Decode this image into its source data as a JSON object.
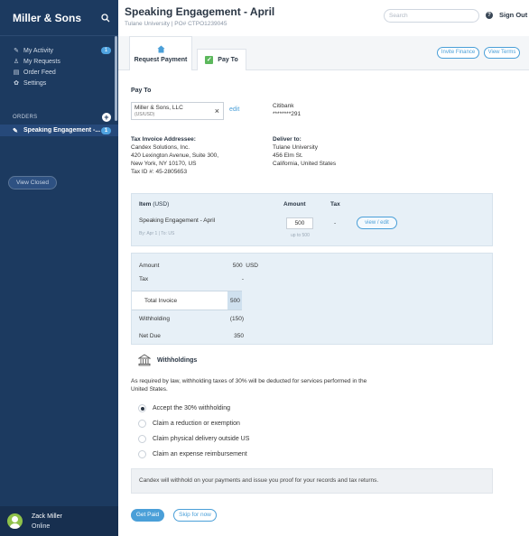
{
  "sidebar": {
    "brand": "Miller & Sons",
    "nav": [
      {
        "label": "My Activity",
        "badge": "1",
        "icon": "activity-icon"
      },
      {
        "label": "My Requests",
        "icon": "person-icon"
      },
      {
        "label": "Order Feed",
        "icon": "document-icon"
      },
      {
        "label": "Settings",
        "icon": "gear-icon"
      }
    ],
    "orders_heading": "ORDERS",
    "active_order": {
      "label": "Speaking Engagement -...",
      "badge": "1"
    },
    "view_closed": "View Closed",
    "user": {
      "name": "Zack Miller",
      "status": "Online"
    }
  },
  "header": {
    "title": "Speaking Engagement - April",
    "subtitle": "Tulane University | PO# CTPO1239045",
    "search_placeholder": "Search",
    "sign_out": "Sign Out"
  },
  "tabs": {
    "request_payment": "Request Payment",
    "pay_to": "Pay To",
    "invite_finance": "Invite Finance",
    "view_terms": "View Terms"
  },
  "pay_to": {
    "label": "Pay To",
    "vendor_name": "Miller & Sons, LLC",
    "vendor_currency": "(US/USD)",
    "edit": "edit",
    "bank_name": "Citibank",
    "bank_account": "********291"
  },
  "invoice": {
    "addressee_label": "Tax Invoice Addressee:",
    "addressee_lines": [
      "Candex Solutions, Inc.",
      "420 Lexington Avenue, Suite 300,",
      "New York, NY 10170, US",
      "Tax ID #: 45-2805653"
    ],
    "deliver_label": "Deliver to:",
    "deliver_lines": [
      "Tulane University",
      "456 Elm St.",
      "California, United States"
    ]
  },
  "item": {
    "header_item": "Item",
    "header_currency": "(USD)",
    "header_amount": "Amount",
    "header_tax": "Tax",
    "name": "Speaking Engagement - April",
    "by_line": "By: Apr 1 | To: US",
    "amount": "500",
    "up_to": "up to 500",
    "tax": "-",
    "view_edit": "view / edit"
  },
  "summary": {
    "amount_label": "Amount",
    "amount_value": "500",
    "amount_currency": "USD",
    "tax_label": "Tax",
    "tax_value": "-",
    "total_label": "Total Invoice",
    "total_value": "500",
    "withholding_label": "Withholding",
    "withholding_value": "(150)",
    "net_label": "Net Due",
    "net_value": "350"
  },
  "withholdings": {
    "title": "Withholdings",
    "description_line1": "As required by law, withholding taxes of 30% will be deducted for services performed in the",
    "description_line2": "United States.",
    "options": [
      {
        "label": "Accept the 30% withholding",
        "selected": true
      },
      {
        "label": "Claim a reduction or exemption",
        "selected": false
      },
      {
        "label": "Claim physical delivery outside US",
        "selected": false
      },
      {
        "label": "Claim an expense reimbursement",
        "selected": false
      }
    ],
    "notice": "Candex will withhold on your payments and issue you proof for your records and tax returns."
  },
  "actions": {
    "get_paid": "Get Paid",
    "skip": "Skip for now"
  }
}
